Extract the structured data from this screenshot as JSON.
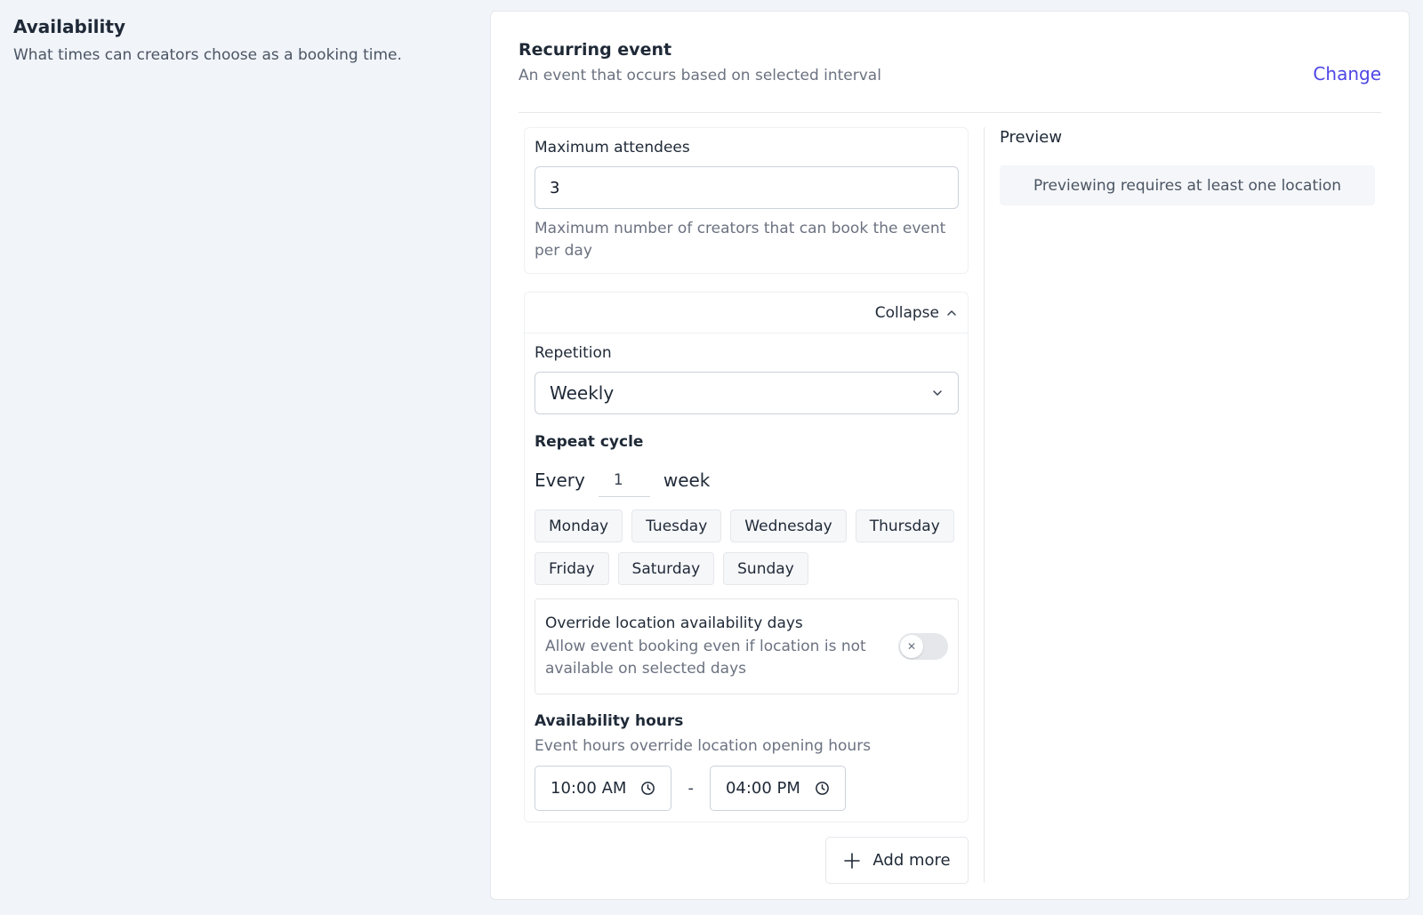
{
  "section": {
    "title": "Availability",
    "subtitle": "What times can creators choose as a booking time."
  },
  "event": {
    "title": "Recurring event",
    "subtitle": "An event that occurs based on selected interval",
    "change_label": "Change"
  },
  "attendees": {
    "label": "Maximum attendees",
    "value": "3",
    "help": "Maximum number of creators that can book the event per day"
  },
  "collapse": {
    "label": "Collapse",
    "icon": "chevron-up-icon"
  },
  "repetition": {
    "label": "Repetition",
    "selected": "Weekly",
    "icon": "chevron-down-icon"
  },
  "repeat_cycle": {
    "label": "Repeat cycle",
    "prefix": "Every",
    "value": "1",
    "unit": "week"
  },
  "days": [
    "Monday",
    "Tuesday",
    "Wednesday",
    "Thursday",
    "Friday",
    "Saturday",
    "Sunday"
  ],
  "override": {
    "title": "Override location availability days",
    "subtitle": "Allow event booking even if location is not available on selected days",
    "enabled": false
  },
  "hours": {
    "title": "Availability hours",
    "subtitle": "Event hours override location opening hours",
    "start": "10:00 AM",
    "separator": "-",
    "end": "04:00 PM"
  },
  "add_more_label": "Add more",
  "preview": {
    "title": "Preview",
    "message": "Previewing requires at least one location"
  },
  "colors": {
    "accent": "#4f46e5",
    "background": "#f1f4f9"
  }
}
